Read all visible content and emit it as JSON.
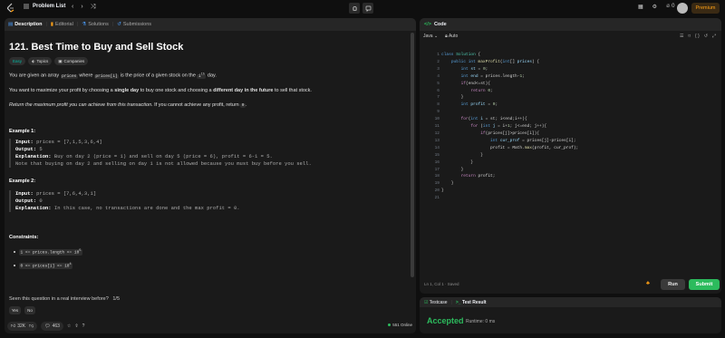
{
  "topbar": {
    "problem_list": "Problem List",
    "streak_count": "0",
    "premium": "Premium"
  },
  "left": {
    "tabs": [
      "Description",
      "Editorial",
      "Solutions",
      "Submissions"
    ],
    "title": "121. Best Time to Buy and Sell Stock",
    "tags": [
      "Easy",
      "Topics",
      "Companies"
    ],
    "desc1_a": "You are given an array ",
    "desc1_code1": "prices",
    "desc1_b": " where ",
    "desc1_code2": "prices[i]",
    "desc1_c": " is the price of a given stock on the ",
    "desc1_code3": "i",
    "desc1_sup": "th",
    "desc1_d": " day.",
    "desc2_a": "You want to maximize your profit by choosing a ",
    "desc2_b1": "single day",
    "desc2_c": " to buy one stock and choosing a ",
    "desc2_b2": "different day in the future",
    "desc2_d": " to sell that stock.",
    "desc3_a": "Return the maximum profit you can achieve from this transaction",
    "desc3_b": ". If you cannot achieve any profit, return ",
    "desc3_code": "0",
    "desc3_c": ".",
    "examples": [
      {
        "title": "Example 1:",
        "input_label": "Input:",
        "input": " prices = [7,1,5,3,6,4]",
        "output_label": "Output:",
        "output": " 5",
        "expl_label": "Explanation:",
        "expl": " Buy on day 2 (price = 1) and sell on day 5 (price = 6), profit = 6-1 = 5.",
        "note": "Note that buying on day 2 and selling on day 1 is not allowed because you must buy before you sell."
      },
      {
        "title": "Example 2:",
        "input_label": "Input:",
        "input": " prices = [7,6,4,3,1]",
        "output_label": "Output:",
        "output": " 0",
        "expl_label": "Explanation:",
        "expl": " In this case, no transactions are done and the max profit = 0."
      }
    ],
    "constraints_title": "Constraints:",
    "constraints": [
      "1 <= prices.length <= 10",
      "0 <= prices[i] <= 10"
    ],
    "constraint_exps": [
      "5",
      "4"
    ],
    "seen_text": "Seen this question in a real interview before?",
    "seen_count": "1/5",
    "yes": "Yes",
    "no": "No",
    "likes": "32K",
    "comments": "463",
    "online": "551 Online"
  },
  "code": {
    "tab": "Code",
    "language": "Java",
    "mode": "Auto",
    "status": "Ln 1, Col 1  ·  Saved",
    "run": "Run",
    "submit": "Submit"
  },
  "test": {
    "tabs": [
      "Testcase",
      "Test Result"
    ],
    "result": "Accepted",
    "runtime": "Runtime: 0 ms"
  },
  "colors": {
    "accent": "#ffa116",
    "success": "#2cbb5d",
    "easy": "#00b8a3",
    "panel": "#1a1a1a",
    "bg": "#0f0f0f"
  }
}
